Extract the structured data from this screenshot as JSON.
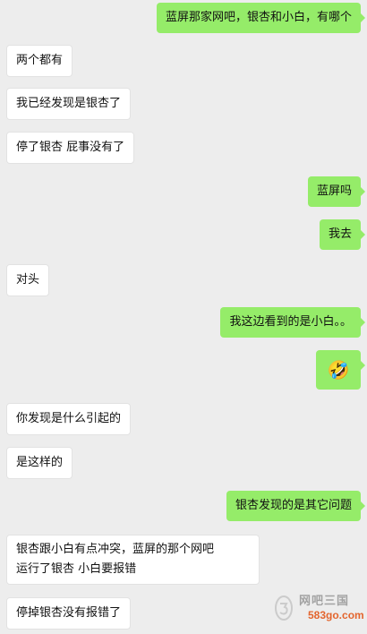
{
  "messages": [
    {
      "side": "right",
      "text": "蓝屏那家网吧，银杏和小白，有哪个"
    },
    {
      "side": "left",
      "text": "两个都有"
    },
    {
      "side": "left",
      "text": "我已经发现是银杏了"
    },
    {
      "side": "left",
      "text": "停了银杏 屁事没有了"
    },
    {
      "side": "right",
      "text": "蓝屏吗"
    },
    {
      "side": "right",
      "text": "我去"
    },
    {
      "side": "left",
      "text": "对头"
    },
    {
      "side": "right",
      "text": "我这边看到的是小白。。"
    },
    {
      "side": "right",
      "emoji": "laughing-tears-emoji",
      "text": "🤣"
    },
    {
      "side": "left",
      "text": "你发现是什么引起的"
    },
    {
      "side": "left",
      "text": "是这样的"
    },
    {
      "side": "right",
      "text": "银杏发现的是其它问题"
    },
    {
      "side": "left",
      "lines": [
        "银杏跟小白有点冲突，蓝屏的那个网吧",
        "运行了银杏 小白要报错"
      ]
    },
    {
      "side": "left",
      "text": "停掉银杏没有报错了"
    }
  ],
  "watermark": {
    "site_name": "网吧三国",
    "url": "583go.com"
  },
  "colors": {
    "background": "#ededed",
    "outgoing_bubble": "#95ec69",
    "incoming_bubble": "#ffffff",
    "watermark_url": "#e2571a"
  }
}
